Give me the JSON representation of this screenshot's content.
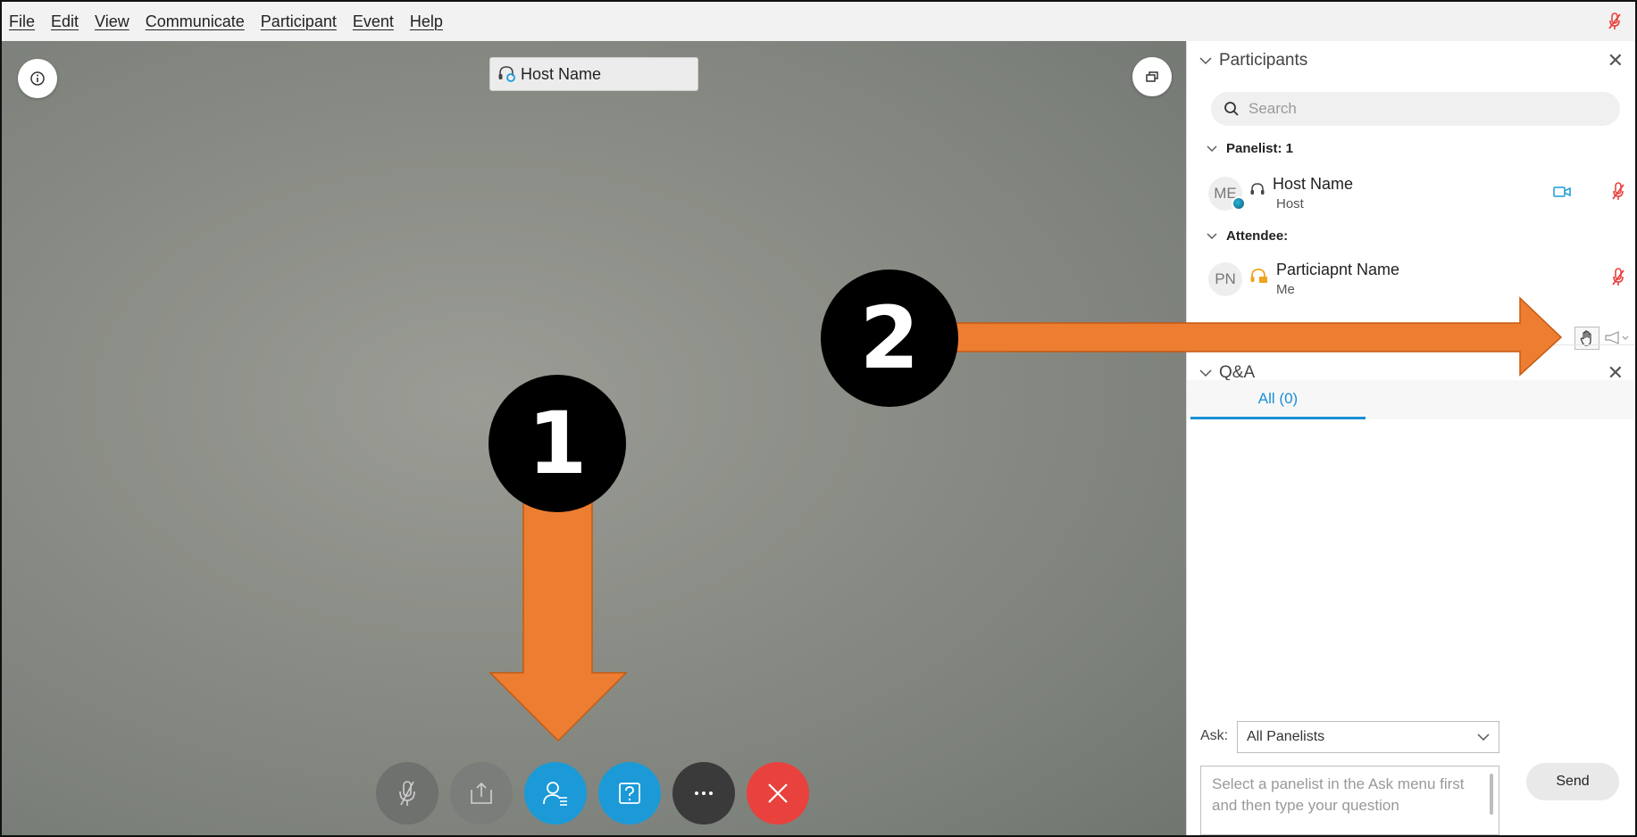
{
  "menu": [
    "File",
    "Edit",
    "View",
    "Communicate",
    "Participant",
    "Event",
    "Help"
  ],
  "stage": {
    "host_label": "Host Name"
  },
  "controls": [
    "mute",
    "share",
    "participants",
    "qa",
    "more",
    "leave"
  ],
  "annotations": {
    "badge1": "1",
    "badge2": "2",
    "arrow_color": "#ED7D31"
  },
  "participants": {
    "title": "Participants",
    "search_placeholder": "Search",
    "panelist_header": "Panelist: 1",
    "attendee_header": "Attendee:",
    "host": {
      "initials": "ME",
      "name": "Host Name",
      "role": "Host"
    },
    "attendee": {
      "initials": "PN",
      "name": "Particiapnt Name",
      "role": "Me"
    }
  },
  "qa": {
    "title": "Q&A",
    "tab_all": "All (0)",
    "ask_label": "Ask:",
    "ask_value": "All Panelists",
    "question_placeholder": "Select a panelist in the Ask menu first and then type your question",
    "send_label": "Send"
  },
  "colors": {
    "accent": "#1A9AD7",
    "mute_red": "#E8413E",
    "leave_red": "#E8413E"
  }
}
